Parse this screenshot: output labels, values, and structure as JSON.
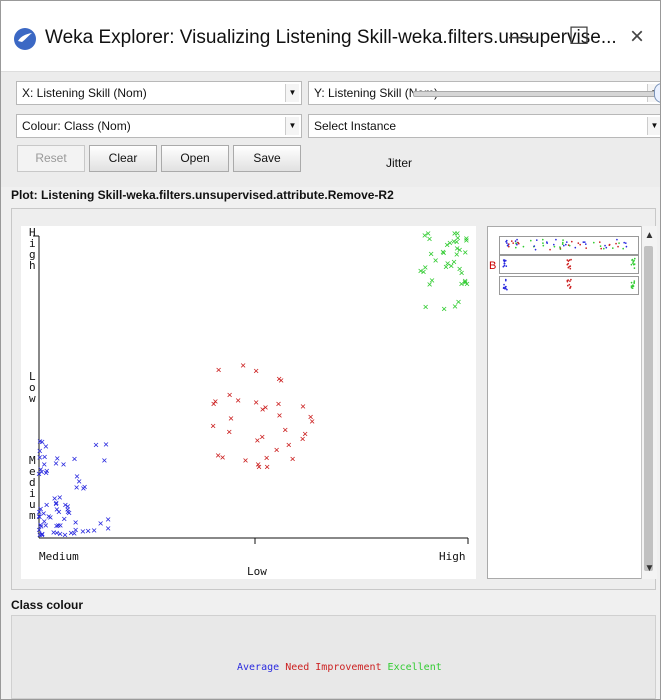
{
  "window": {
    "title": "Weka Explorer: Visualizing Listening Skill-weka.filters.unsupervise...",
    "icon": "weka-bird-icon"
  },
  "controls": {
    "x_axis": "X: Listening Skill (Nom)",
    "y_axis": "Y: Listening Skill (Nom)",
    "colour": "Colour: Class (Nom)",
    "instance": "Select Instance",
    "buttons": {
      "reset": "Reset",
      "clear": "Clear",
      "open": "Open",
      "save": "Save"
    },
    "jitter_label": "Jitter",
    "jitter_value": 1.0
  },
  "plot": {
    "title": "Plot: Listening Skill-weka.filters.unsupervised.attribute.Remove-R2",
    "x_ticks": [
      "Medium",
      "Low",
      "High"
    ],
    "y_ticks": [
      "High",
      "Low",
      "Medium"
    ],
    "x_axis_label": "Low"
  },
  "side_panel": {
    "row_letter": "B"
  },
  "class_colour": {
    "label": "Class colour",
    "classes": [
      {
        "name": "Average",
        "color": "#2a2adf"
      },
      {
        "name": "Need Improvement",
        "color": "#cc2222"
      },
      {
        "name": "Excellent",
        "color": "#33cc33"
      }
    ]
  },
  "chart_data": {
    "type": "scatter",
    "x_categories": [
      "Medium",
      "Low",
      "High"
    ],
    "y_categories": [
      "Medium",
      "Low",
      "High"
    ],
    "series": [
      {
        "name": "Average",
        "color": "#2a2adf",
        "x": "Medium",
        "y": "Medium",
        "approx_points": 70
      },
      {
        "name": "Need Improvement",
        "color": "#cc2222",
        "x": "Low",
        "y": "Low",
        "approx_points": 35
      },
      {
        "name": "Excellent",
        "color": "#33cc33",
        "x": "High",
        "y": "High",
        "approx_points": 40
      }
    ],
    "jitter": 1.0,
    "grid": false
  }
}
